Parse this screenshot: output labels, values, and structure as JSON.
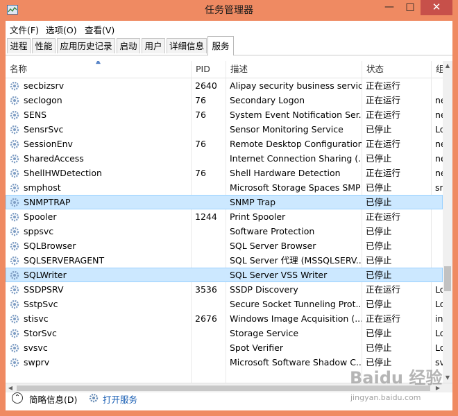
{
  "window": {
    "title": "任务管理器",
    "minimize": "—",
    "maximize": "□",
    "close": "✕"
  },
  "menu": [
    {
      "label": "文件(F)"
    },
    {
      "label": "选项(O)"
    },
    {
      "label": "查看(V)"
    }
  ],
  "tabs": [
    {
      "label": "进程"
    },
    {
      "label": "性能"
    },
    {
      "label": "应用历史记录"
    },
    {
      "label": "启动"
    },
    {
      "label": "用户"
    },
    {
      "label": "详细信息"
    },
    {
      "label": "服务",
      "active": true
    }
  ],
  "columns": {
    "name": "名称",
    "pid": "PID",
    "desc": "描述",
    "status": "状态",
    "group": "组"
  },
  "services": [
    {
      "name": "secbizsrv",
      "pid": "2640",
      "desc": "Alipay security business service",
      "status": "正在运行",
      "group": ""
    },
    {
      "name": "seclogon",
      "pid": "76",
      "desc": "Secondary Logon",
      "status": "正在运行",
      "group": "ne"
    },
    {
      "name": "SENS",
      "pid": "76",
      "desc": "System Event Notification Ser...",
      "status": "正在运行",
      "group": "ne"
    },
    {
      "name": "SensrSvc",
      "pid": "",
      "desc": "Sensor Monitoring Service",
      "status": "已停止",
      "group": "Lo"
    },
    {
      "name": "SessionEnv",
      "pid": "76",
      "desc": "Remote Desktop Configuration",
      "status": "正在运行",
      "group": "ne"
    },
    {
      "name": "SharedAccess",
      "pid": "",
      "desc": "Internet Connection Sharing (...",
      "status": "已停止",
      "group": "ne"
    },
    {
      "name": "ShellHWDetection",
      "pid": "76",
      "desc": "Shell Hardware Detection",
      "status": "正在运行",
      "group": "ne"
    },
    {
      "name": "smphost",
      "pid": "",
      "desc": "Microsoft Storage Spaces SMP",
      "status": "已停止",
      "group": "sr"
    },
    {
      "name": "SNMPTRAP",
      "pid": "",
      "desc": "SNMP Trap",
      "status": "已停止",
      "group": "",
      "selected": true
    },
    {
      "name": "Spooler",
      "pid": "1244",
      "desc": "Print Spooler",
      "status": "正在运行",
      "group": ""
    },
    {
      "name": "sppsvc",
      "pid": "",
      "desc": "Software Protection",
      "status": "已停止",
      "group": ""
    },
    {
      "name": "SQLBrowser",
      "pid": "",
      "desc": "SQL Server Browser",
      "status": "已停止",
      "group": ""
    },
    {
      "name": "SQLSERVERAGENT",
      "pid": "",
      "desc": "SQL Server 代理 (MSSQLSERV...",
      "status": "已停止",
      "group": ""
    },
    {
      "name": "SQLWriter",
      "pid": "",
      "desc": "SQL Server VSS Writer",
      "status": "已停止",
      "group": "",
      "selected": true
    },
    {
      "name": "SSDPSRV",
      "pid": "3536",
      "desc": "SSDP Discovery",
      "status": "正在运行",
      "group": "Lo"
    },
    {
      "name": "SstpSvc",
      "pid": "",
      "desc": "Secure Socket Tunneling Prot...",
      "status": "已停止",
      "group": "Lo"
    },
    {
      "name": "stisvc",
      "pid": "2676",
      "desc": "Windows Image Acquisition (...",
      "status": "正在运行",
      "group": "in"
    },
    {
      "name": "StorSvc",
      "pid": "",
      "desc": "Storage Service",
      "status": "已停止",
      "group": "Lo"
    },
    {
      "name": "svsvc",
      "pid": "",
      "desc": "Spot Verifier",
      "status": "已停止",
      "group": "Lo"
    },
    {
      "name": "swprv",
      "pid": "",
      "desc": "Microsoft Software Shadow C...",
      "status": "已停止",
      "group": "sv"
    }
  ],
  "footer": {
    "fewer_details": "简略信息(D)",
    "open_services": "打开服务"
  },
  "watermark": {
    "brand": "Baidu 经验",
    "url": "jingyan.baidu.com"
  },
  "colors": {
    "titlebar": "#ef8a62",
    "close": "#c7504a",
    "selection": "#cce8ff",
    "link": "#1a5fb4"
  }
}
